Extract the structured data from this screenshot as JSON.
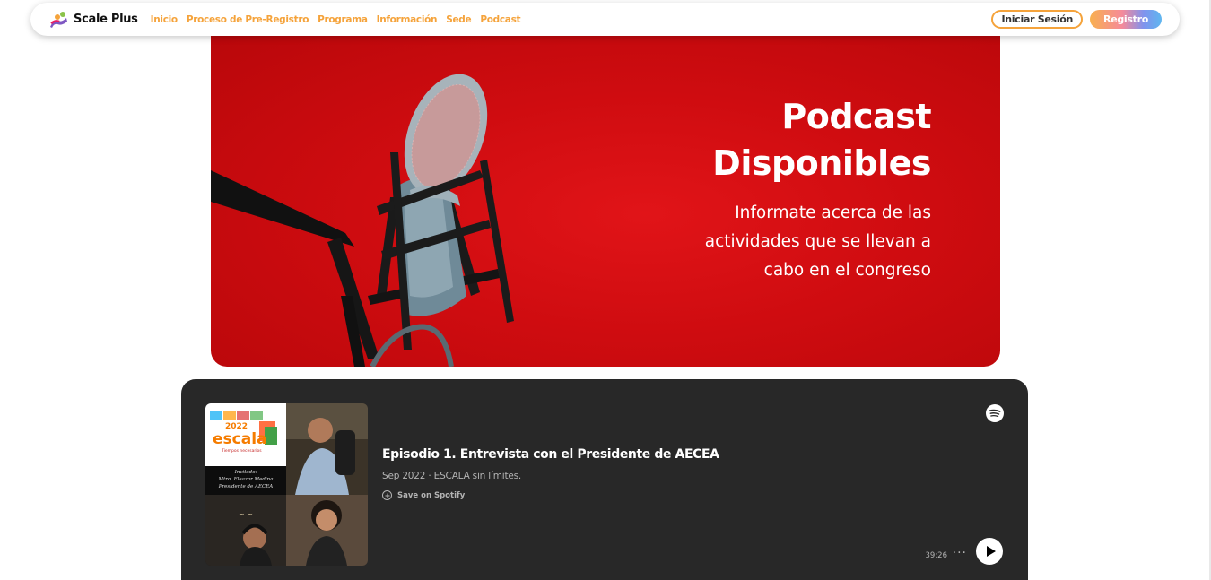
{
  "navbar": {
    "brand": "Scale Plus",
    "links": [
      "Inicio",
      "Proceso de Pre-Registro",
      "Programa",
      "Información",
      "Sede",
      "Podcast"
    ],
    "login_label": "Iniciar Sesión",
    "register_label": "Registro"
  },
  "hero": {
    "title_line1": "Podcast",
    "title_line2": "Disponibles",
    "subtitle": "Informate acerca de las actividades que se llevan a cabo en el congreso"
  },
  "episode": {
    "title": "Episodio 1. Entrevista con el Presidente de AECEA",
    "meta": "Sep 2022 · ESCALA sin límites.",
    "save_label": "Save on Spotify",
    "duration": "39:26",
    "more_label": "···",
    "cover": {
      "year": "2022",
      "logo": "escala",
      "tagline": "Tiempos necesarios",
      "guest_label": "Invitado:",
      "guest_name": "Mtro. Eleazar Medina",
      "guest_role": "Presidente de AECEA"
    }
  },
  "colors": {
    "accent": "#f5a33b",
    "hero_red": "#cf0c10",
    "player_bg": "#282828"
  },
  "icons": [
    "scale-plus-logo-icon",
    "spotify-icon",
    "plus-circle-icon",
    "more-icon",
    "play-icon"
  ]
}
